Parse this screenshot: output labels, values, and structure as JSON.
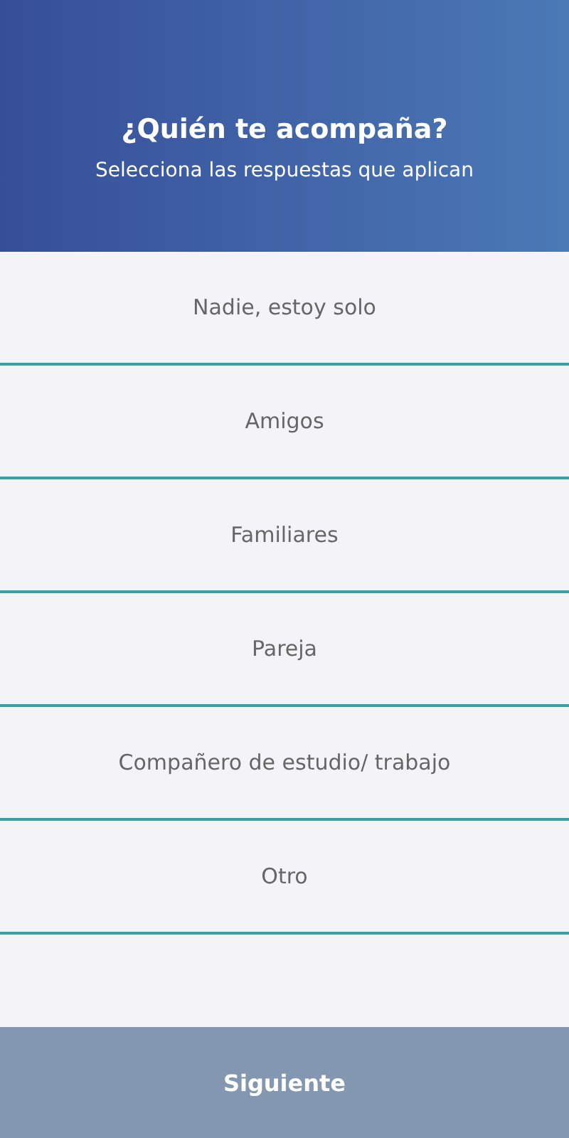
{
  "header": {
    "title": "¿Quién te acompaña?",
    "subtitle": "Selecciona las respuestas que aplican"
  },
  "options": [
    {
      "label": "Nadie, estoy solo",
      "selected": false
    },
    {
      "label": "Amigos",
      "selected": false
    },
    {
      "label": "Familiares",
      "selected": false
    },
    {
      "label": "Pareja",
      "selected": false
    },
    {
      "label": "Compañero de estudio/ trabajo",
      "selected": false
    },
    {
      "label": "Otro",
      "selected": false
    }
  ],
  "next_button": {
    "label": "Siguiente"
  }
}
